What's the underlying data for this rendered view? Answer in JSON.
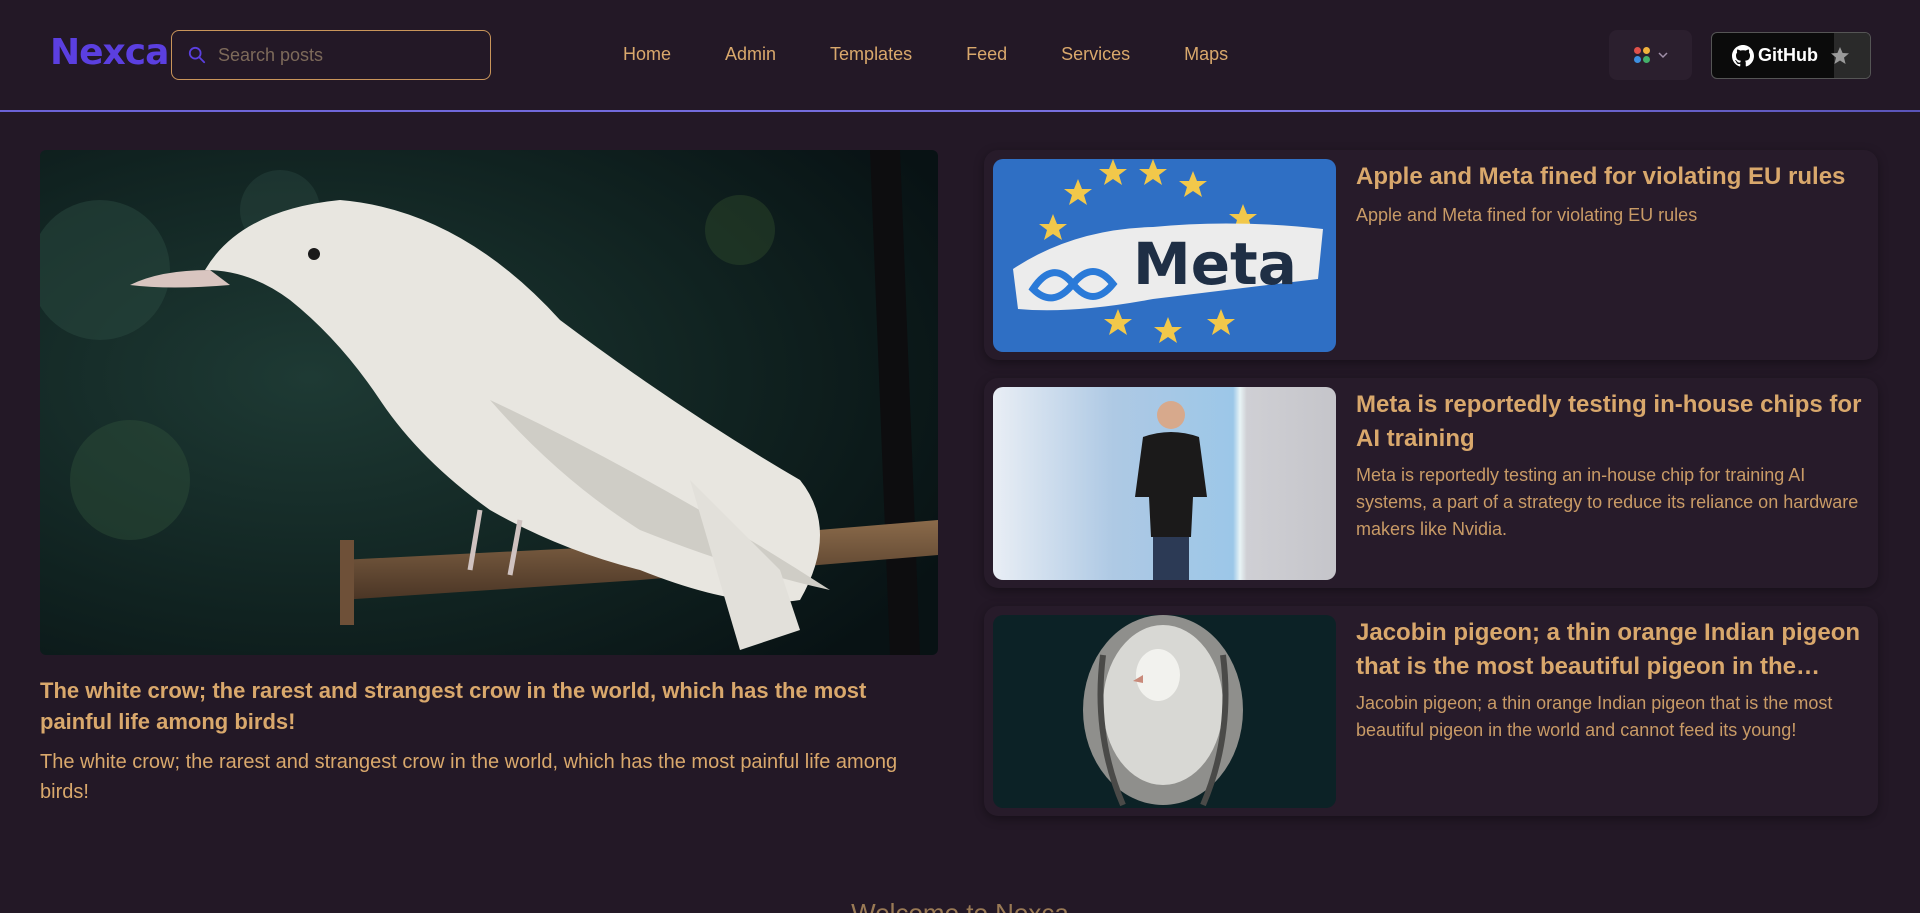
{
  "header": {
    "logo": "Nexca",
    "search_placeholder": "Search posts",
    "nav": [
      "Home",
      "Admin",
      "Templates",
      "Feed",
      "Services",
      "Maps"
    ],
    "github_label": "GitHub",
    "icons": {
      "search": "search-icon",
      "palette": "palette-icon",
      "chevron": "chevron-down-icon",
      "github": "github-icon",
      "star": "star-icon"
    }
  },
  "colors": {
    "background": "#231826",
    "logo": "#5b3fe0",
    "text_accent": "#d9a86c",
    "progress": "#6b62d6"
  },
  "featured": {
    "title": "The white crow; the rarest and strangest crow in the world, which has the most painful life among birds!",
    "description": "The white crow; the rarest and strangest crow in the world, which has the most painful life among birds!",
    "image_alt": "White crow perched on a branch"
  },
  "posts": [
    {
      "title": "Apple and Meta fined for violating EU rules",
      "description": "Apple and Meta fined for violating EU rules",
      "image_text": "Meta"
    },
    {
      "title": "Meta is reportedly testing in-house chips for AI training",
      "description": "Meta is reportedly testing an in-house chip for training AI systems, a part of a strategy to reduce its reliance on hardware makers like Nvidia."
    },
    {
      "title": "Jacobin pigeon; a thin orange Indian pigeon that is the most beautiful pigeon in the world and cannot feed its young!",
      "description": "Jacobin pigeon; a thin orange Indian pigeon that is the most beautiful pigeon in the world and cannot feed its young!"
    }
  ],
  "welcome": "Welcome to  Nexca"
}
